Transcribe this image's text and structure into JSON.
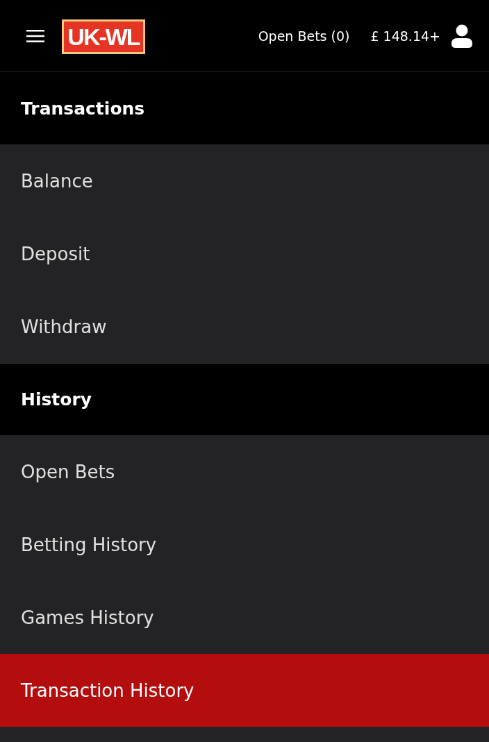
{
  "header": {
    "logo": "UK-WL",
    "open_bets": "Open Bets (0)",
    "balance": "£ 148.14+"
  },
  "sections": [
    {
      "title": "Transactions",
      "items": [
        {
          "label": "Balance",
          "selected": false
        },
        {
          "label": "Deposit",
          "selected": false
        },
        {
          "label": "Withdraw",
          "selected": false
        }
      ]
    },
    {
      "title": "History",
      "items": [
        {
          "label": "Open Bets",
          "selected": false
        },
        {
          "label": "Betting History",
          "selected": false
        },
        {
          "label": "Games History",
          "selected": false
        },
        {
          "label": "Transaction History",
          "selected": true
        }
      ]
    }
  ]
}
